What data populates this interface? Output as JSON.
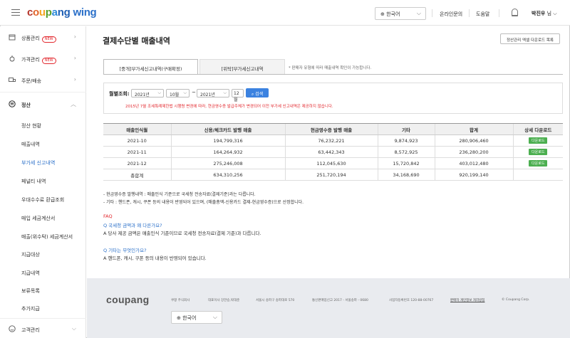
{
  "header": {
    "logo": {
      "c1": "c",
      "c2": "o",
      "c3": "u",
      "c4": "p",
      "c5": "a",
      "c6": "ng",
      "wing": "wing"
    },
    "language": "한국어",
    "links": [
      "온라인문의",
      "도움말"
    ],
    "user_name": "박진우",
    "user_suffix": "님"
  },
  "sidebar": {
    "items": [
      {
        "label": "상품관리",
        "badge": "NEW"
      },
      {
        "label": "가격관리",
        "badge": "NEW"
      },
      {
        "label": "주문/배송"
      },
      {
        "label": "정산"
      }
    ],
    "sub_items": [
      "정산 현황",
      "매출내역",
      "부가세 신고내역",
      "페널티 내역",
      "우대수수료 환급조회",
      "매입 세금계산서",
      "매출(위수탁) 세금계산서",
      "지급대상",
      "지급내역",
      "보류목록",
      "추가지급"
    ],
    "bottom_item": "고객관리"
  },
  "main": {
    "title": "결제수단별 매출내역",
    "excel_button": "정산관리 엑셀 다운로드 목록",
    "tabs": [
      "[중개]부가세신고내역(구매확정)",
      "[위탁]부가세신고내역"
    ],
    "tab_note": "* 판매자 유형에 따라 매출내역 확인이 가능합니다.",
    "search": {
      "label": "월별조회:",
      "from_year": "2021년",
      "from_month": "10월",
      "tilde": "~",
      "to_year": "2021년",
      "to_month": "12월",
      "button": "검색",
      "warning": "2015년 7월 조세특례제한법 시행령 변경에 따라, 현금영수증 발급주체가 변경되어 이전 부가세 신고내역은 제공하지 않습니다."
    },
    "table": {
      "headers": [
        "매출인식월",
        "신용/체크카드 발행 매출",
        "현금영수증 발행 매출",
        "기타",
        "합계",
        "상세 다운로드"
      ],
      "rows": [
        [
          "2021-10",
          "194,799,316",
          "76,232,221",
          "9,874,923",
          "280,906,460",
          "다운로드"
        ],
        [
          "2021-11",
          "164,264,932",
          "63,442,343",
          "8,572,925",
          "236,280,200",
          "다운로드"
        ],
        [
          "2021-12",
          "275,246,008",
          "112,045,630",
          "15,720,842",
          "403,012,480",
          "다운로드"
        ]
      ],
      "total": [
        "총합계",
        "634,310,256",
        "251,720,194",
        "34,168,690",
        "920,199,140"
      ]
    },
    "notes": [
      "- 현금영수증 발행내역 : 매출인식 기준으로 국세청 전송자료(결제기준)과는 다릅니다.",
      "- 기타 : 핸드폰, 캐시, 쿠폰 등의 내용이 반영되어 있으며, (매출총액-신용카드 결제-현금영수증)으로 산정합니다."
    ],
    "faq": {
      "title": "FAQ",
      "q1": "Q 국세청 금액과 왜 다른가요?",
      "a1": "A 당사 제공 금액은 매출인식 기준이므로 국세청 전송자료(결제 기준)과 다릅니다.",
      "q2": "Q 기타는 무엇인가요?",
      "a2": "A 핸드폰, 캐시, 쿠폰 등의 내용이 반영되어 있습니다."
    }
  },
  "footer": {
    "logo": "coupang",
    "info": [
      "쿠팡 주식회사",
      "대표이사 강한승,박대준",
      "서울시 송파구 송파대로 570",
      "통신판매업신고 2017 - 서울송파 - 0680",
      "사업자등록번호 120-88-00767",
      "판매자 개인정보 처리방침",
      "© Coupang Corp."
    ],
    "language": "한국어"
  }
}
